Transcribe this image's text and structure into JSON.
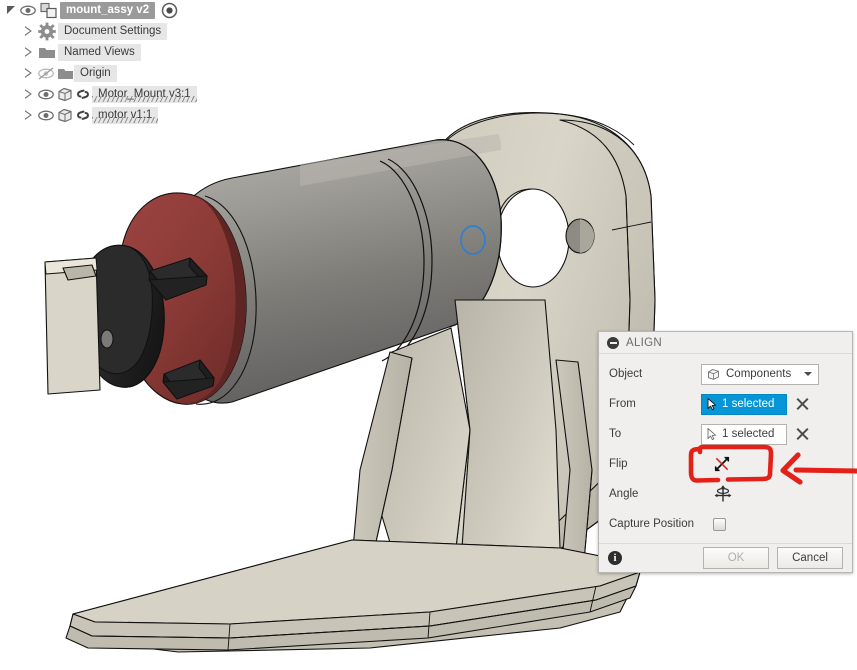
{
  "app": {
    "canvas_background": "#ffffff"
  },
  "browser": {
    "root": {
      "label": "mount_assy v2",
      "expand_icon": "triangle-expanded-icon",
      "visibility_icon": "eye-icon",
      "type_icon": "assembly-icon",
      "radio_icon": "active-component-icon"
    },
    "items": [
      {
        "label": "Document Settings",
        "expand_icon": "triangle-collapsed-icon",
        "type_icon": "gear-icon",
        "visibility_icon": "",
        "link_icon": "",
        "hatched": false
      },
      {
        "label": "Named Views",
        "expand_icon": "triangle-collapsed-icon",
        "type_icon": "folder-icon",
        "visibility_icon": "",
        "link_icon": "",
        "hatched": false
      },
      {
        "label": "Origin",
        "expand_icon": "triangle-collapsed-icon",
        "type_icon": "folder-icon",
        "visibility_icon": "eye-hidden-icon",
        "link_icon": "",
        "hatched": false
      },
      {
        "label": "Motor_Mount v3:1",
        "expand_icon": "triangle-collapsed-icon",
        "type_icon": "component-icon",
        "visibility_icon": "eye-icon",
        "link_icon": "linked-icon",
        "hatched": true
      },
      {
        "label": "motor v1:1",
        "expand_icon": "triangle-collapsed-icon",
        "type_icon": "component-icon",
        "visibility_icon": "eye-icon",
        "link_icon": "linked-icon",
        "hatched": true
      }
    ]
  },
  "dialog": {
    "title": "ALIGN",
    "collapse_icon": "collapse-icon",
    "object": {
      "label": "Object",
      "value": "Components",
      "icon": "cube-icon",
      "dropdown_icon": "chevron-down-icon"
    },
    "from": {
      "label": "From",
      "value": "1 selected",
      "icon": "cursor-arrow-icon",
      "clear_icon": "close-icon",
      "active": true
    },
    "to": {
      "label": "To",
      "value": "1 selected",
      "icon": "cursor-arrow-icon",
      "clear_icon": "close-icon",
      "active": false
    },
    "flip": {
      "label": "Flip",
      "icon": "flip-disabled-icon"
    },
    "angle": {
      "label": "Angle",
      "icon": "rotate-move-icon"
    },
    "capture_position": {
      "label": "Capture Position",
      "checked": false,
      "icon": "checkbox-icon"
    },
    "footer": {
      "info_icon": "info-icon",
      "ok_label": "OK",
      "ok_enabled": false,
      "cancel_label": "Cancel"
    },
    "colors": {
      "accent_blue": "#0696d7",
      "panel_bg": "#f0efed",
      "border": "#b8b6b2"
    }
  },
  "annotation": {
    "color": "#e32119",
    "shapes": [
      "highlight-rectangle",
      "pointer-arrow"
    ],
    "target": "flip-control"
  },
  "model": {
    "selection_marker": {
      "shape": "circle",
      "color": "#2f7fd0"
    },
    "colors": {
      "motor_body": "#8b8a85",
      "motor_face_red": "#8e3a36",
      "motor_shaft_black": "#2a2a2a",
      "bracket": "#d6d2c4",
      "outline": "#111111"
    }
  }
}
